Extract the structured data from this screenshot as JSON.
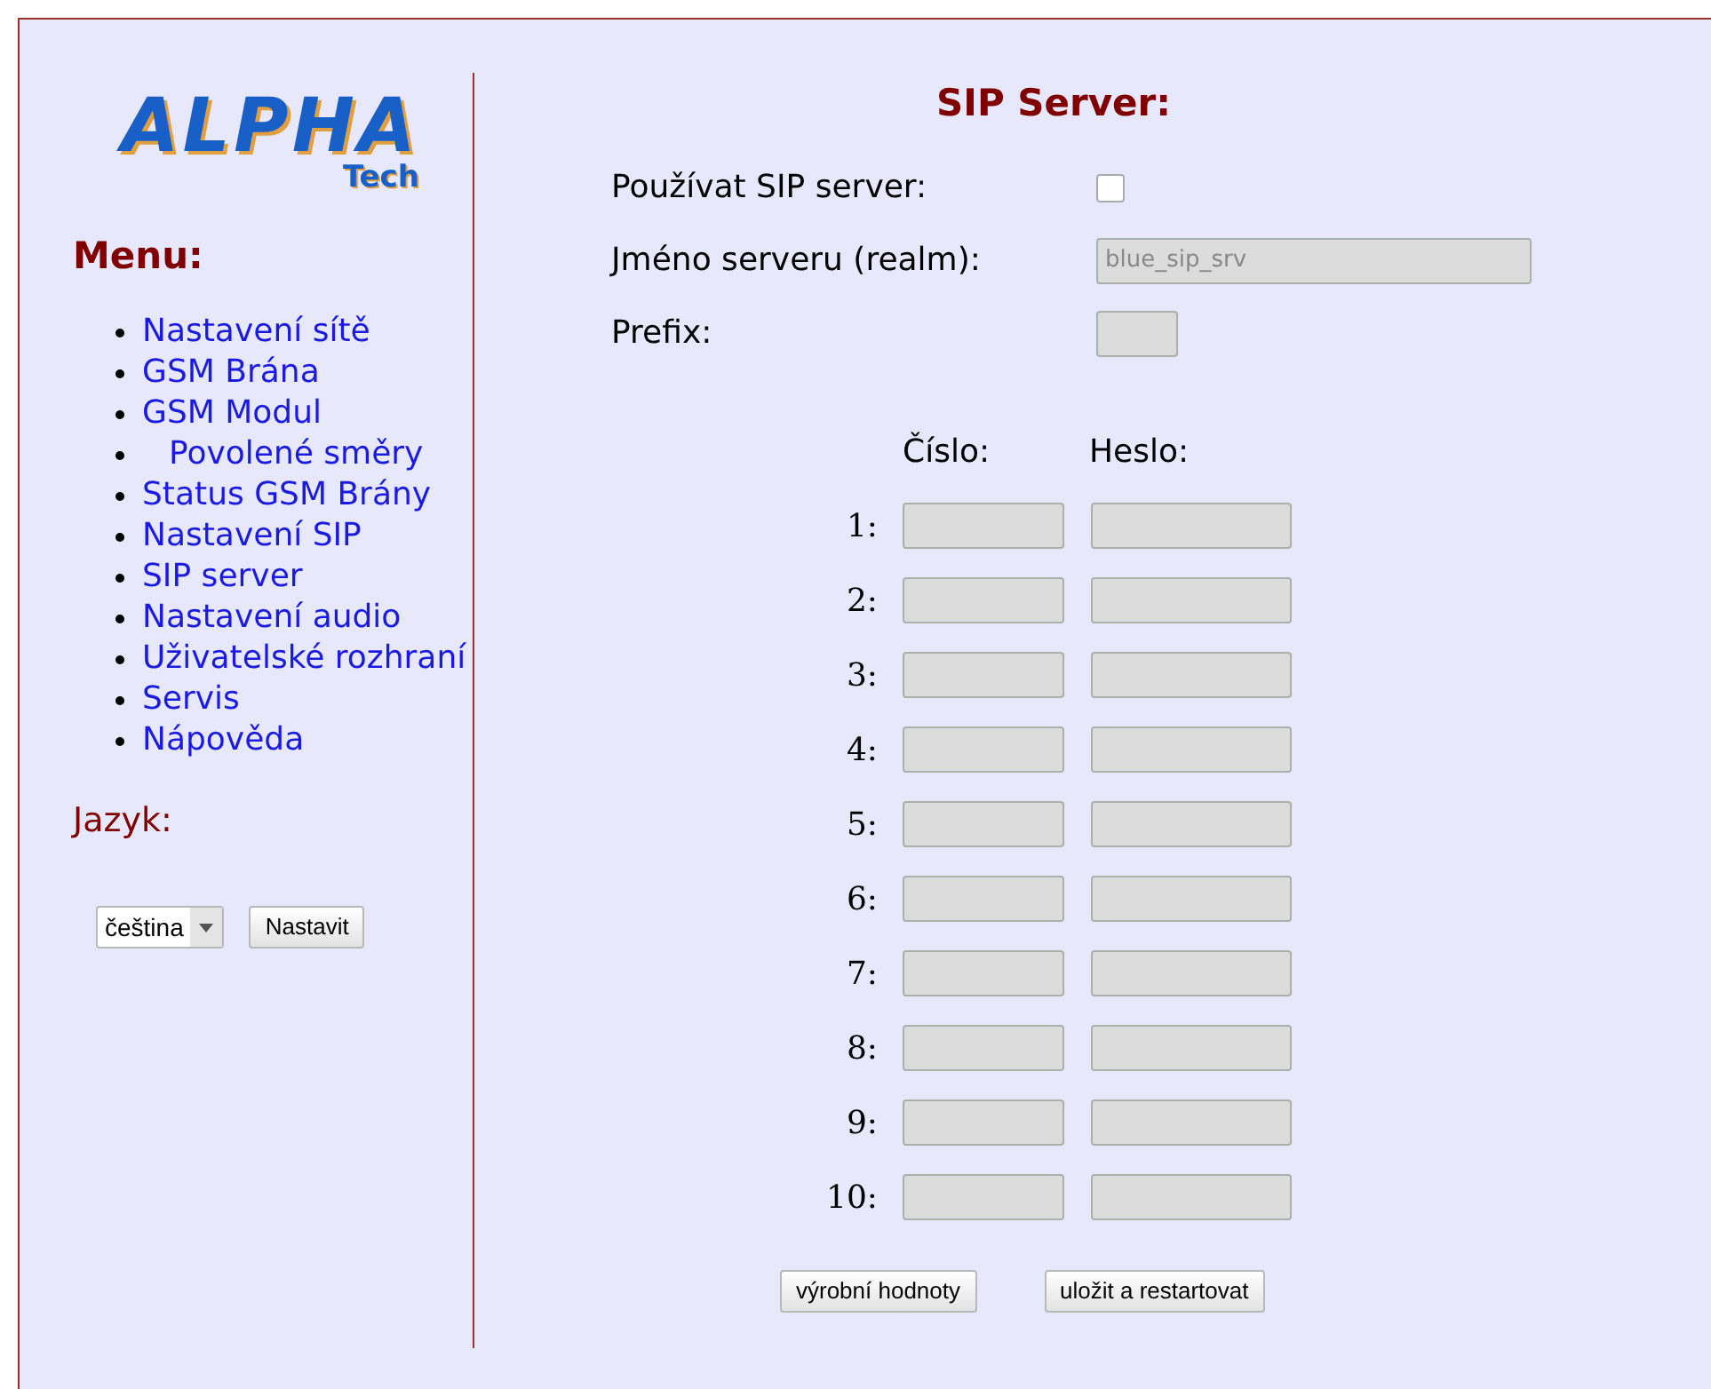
{
  "logo": {
    "name": "ALPHA",
    "sub": "Tech"
  },
  "menu": {
    "title": "Menu:",
    "items": [
      {
        "label": "Nastavení sítě",
        "kind": "link"
      },
      {
        "label": "GSM Brána",
        "kind": "link"
      },
      {
        "label": "GSM Modul",
        "kind": "link"
      },
      {
        "label": "Povolené směry",
        "kind": "sub"
      },
      {
        "label": "Status GSM Brány",
        "kind": "link"
      },
      {
        "label": "Nastavení SIP",
        "kind": "link"
      },
      {
        "label": "SIP server",
        "kind": "link"
      },
      {
        "label": "Nastavení audio",
        "kind": "link"
      },
      {
        "label": "Uživatelské rozhraní",
        "kind": "link"
      },
      {
        "label": "Servis",
        "kind": "link"
      },
      {
        "label": "Nápověda",
        "kind": "link"
      }
    ]
  },
  "language": {
    "title": "Jazyk:",
    "value": "čeština",
    "button": "Nastavit"
  },
  "form": {
    "title": "SIP Server:",
    "use_sip": {
      "label": "Používat SIP server:",
      "checked": false
    },
    "realm": {
      "label": "Jméno serveru (realm):",
      "value": "blue_sip_srv",
      "disabled": true
    },
    "prefix": {
      "label": "Prefix:",
      "disabled": true
    },
    "accounts": {
      "columns": [
        "Číslo:",
        "Heslo:"
      ],
      "rows": [
        {
          "label": "1:"
        },
        {
          "label": "2:"
        },
        {
          "label": "3:"
        },
        {
          "label": "4:"
        },
        {
          "label": "5:"
        },
        {
          "label": "6:"
        },
        {
          "label": "7:"
        },
        {
          "label": "8:"
        },
        {
          "label": "9:"
        },
        {
          "label": "10:"
        }
      ]
    },
    "buttons": [
      "výrobní hodnoty",
      "uložit a restartovat"
    ]
  }
}
